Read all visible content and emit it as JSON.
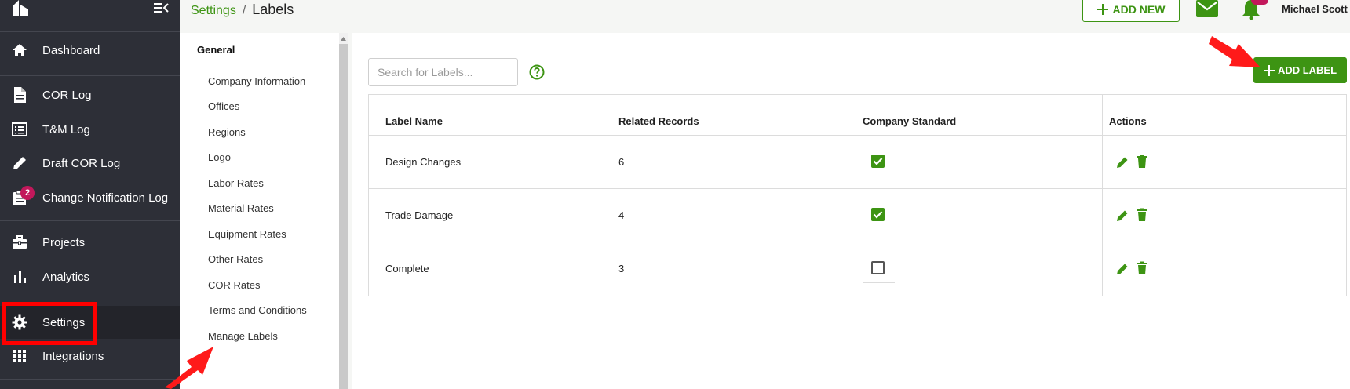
{
  "sidebar": {
    "items": [
      {
        "label": "Dashboard",
        "icon": "home-icon"
      },
      {
        "label": "COR Log",
        "icon": "document-icon"
      },
      {
        "label": "T&M Log",
        "icon": "list-icon"
      },
      {
        "label": "Draft COR Log",
        "icon": "pencil-icon"
      },
      {
        "label": "Change Notification Log",
        "icon": "clipboard-icon",
        "badge": "2"
      },
      {
        "label": "Projects",
        "icon": "briefcase-icon"
      },
      {
        "label": "Analytics",
        "icon": "bar-chart-icon"
      },
      {
        "label": "Settings",
        "icon": "gear-icon"
      },
      {
        "label": "Integrations",
        "icon": "grid-icon"
      }
    ]
  },
  "header": {
    "breadcrumb_parent": "Settings",
    "breadcrumb_separator": "/",
    "page_title": "Labels",
    "add_new_label": "ADD NEW",
    "user_name": "Michael Scott"
  },
  "settings_menu": {
    "heading": "General",
    "items": [
      "Company Information",
      "Offices",
      "Regions",
      "Logo",
      "Labor Rates",
      "Material Rates",
      "Equipment Rates",
      "Other Rates",
      "COR Rates",
      "Terms and Conditions",
      "Manage Labels"
    ]
  },
  "labels_panel": {
    "search_placeholder": "Search for Labels...",
    "add_label": "ADD LABEL",
    "columns": [
      "Label Name",
      "Related Records",
      "Company Standard",
      "Actions"
    ],
    "rows": [
      {
        "name": "Design Changes",
        "records": "6",
        "standard": true
      },
      {
        "name": "Trade Damage",
        "records": "4",
        "standard": true
      },
      {
        "name": "Complete",
        "records": "3",
        "standard": false
      }
    ]
  },
  "colors": {
    "accent": "#3d9413",
    "sidebar_bg": "#2d2f37",
    "badge": "#c2185b",
    "highlight": "#ff0000"
  }
}
